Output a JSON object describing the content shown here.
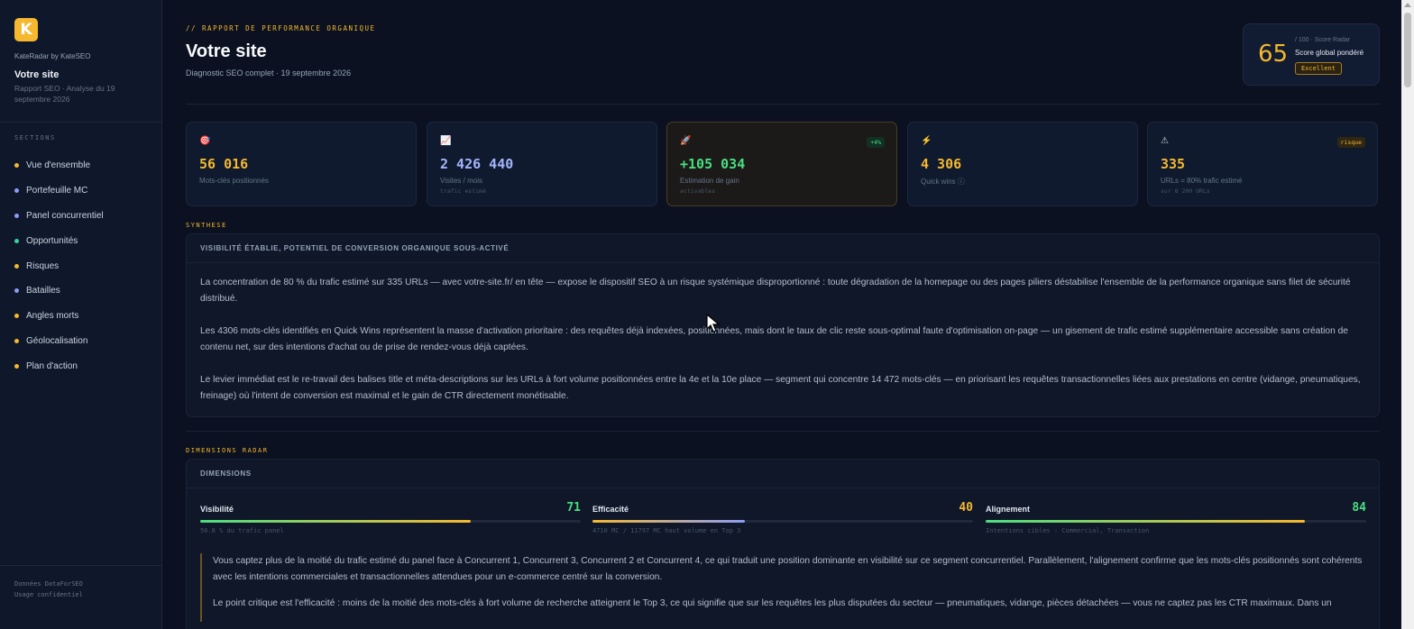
{
  "sidebar": {
    "logo_letter": "K",
    "brand": "KateRadar by KateSEO",
    "site_name": "Votre site",
    "site_sub": "Rapport SEO · Analyse du 19 septembre 2026",
    "sections_label": "SECTIONS",
    "items": [
      {
        "label": "Vue d'ensemble",
        "color": "#f5b82e"
      },
      {
        "label": "Portefeuille MC",
        "color": "#8b9cf4"
      },
      {
        "label": "Panel concurrentiel",
        "color": "#8b9cf4"
      },
      {
        "label": "Opportunités",
        "color": "#34d399"
      },
      {
        "label": "Risques",
        "color": "#f5b82e"
      },
      {
        "label": "Batailles",
        "color": "#8b9cf4"
      },
      {
        "label": "Angles morts",
        "color": "#f5b82e"
      },
      {
        "label": "Géolocalisation",
        "color": "#f5b82e"
      },
      {
        "label": "Plan d'action",
        "color": "#f5b82e"
      }
    ],
    "footer_line1": "Données DataForSEO",
    "footer_line2": "Usage confidentiel"
  },
  "header": {
    "kicker": "// RAPPORT DE PERFORMANCE ORGANIQUE",
    "title": "Votre site",
    "subtitle": "Diagnostic SEO complet · 19 septembre 2026"
  },
  "score": {
    "value": "65",
    "caption": "/ 100 · Score Radar",
    "label": "Score global pondéré",
    "badge": "Excellent"
  },
  "kpis": [
    {
      "icon": "🎯",
      "icon_name": "target-icon",
      "value": "56 016",
      "label": "Mots-clés positionnés",
      "sub": "",
      "tag": "",
      "color": "#f5b82e"
    },
    {
      "icon": "📈",
      "icon_name": "chart-icon",
      "value": "2 426 440",
      "label": "Visites / mois",
      "sub": "trafic estimé",
      "tag": "",
      "color": "#a5b4fc"
    },
    {
      "icon": "🚀",
      "icon_name": "rocket-icon",
      "value": "+105 034",
      "label": "Estimation de gain",
      "sub": "activables",
      "tag": "+4%",
      "color": "#4ade80"
    },
    {
      "icon": "⚡",
      "icon_name": "lightning-icon",
      "value": "4 306",
      "label": "Quick wins ⓘ",
      "sub": "",
      "tag": "",
      "color": "#f5b82e"
    },
    {
      "icon": "⚠",
      "icon_name": "warning-icon",
      "value": "335",
      "label": "URLs = 80% trafic estimé",
      "sub": "sur 8 200 URLs",
      "tag": "risque",
      "color": "#f5b82e"
    }
  ],
  "synthese": {
    "section_label": "SYNTHESE",
    "heading": "VISIBILITÉ ÉTABLIE, POTENTIEL DE CONVERSION ORGANIQUE SOUS-ACTIVÉ",
    "paragraphs": [
      "La concentration de 80 % du trafic estimé sur 335 URLs — avec votre-site.fr/ en tête — expose le dispositif SEO à un risque systémique disproportionné : toute dégradation de la homepage ou des pages piliers déstabilise l'ensemble de la performance organique sans filet de sécurité distribué.",
      "Les 4306 mots-clés identifiés en Quick Wins représentent la masse d'activation prioritaire : des requêtes déjà indexées, positionnées, mais dont le taux de clic reste sous-optimal faute d'optimisation on-page — un gisement de trafic estimé supplémentaire accessible sans création de contenu net, sur des intentions d'achat ou de prise de rendez-vous déjà captées.",
      "Le levier immédiat est le re-travail des balises title et méta-descriptions sur les URLs à fort volume positionnées entre la 4e et la 10e place — segment qui concentre 14 472 mots-clés — en priorisant les requêtes transactionnelles liées aux prestations en centre (vidange, pneumatiques, freinage) où l'intent de conversion est maximal et le gain de CTR directement monétisable."
    ]
  },
  "dimensions": {
    "section_label": "DIMENSIONS RADAR",
    "heading": "DIMENSIONS",
    "items": [
      {
        "name": "Visibilité",
        "score": "71",
        "percent": 71,
        "color": "#4ade80",
        "gradient": "linear-gradient(90deg,#4ade80,#f5b82e)",
        "note": "56.8 % du trafic panel"
      },
      {
        "name": "Efficacité",
        "score": "40",
        "percent": 40,
        "color": "#f5b82e",
        "gradient": "linear-gradient(90deg,#f5b82e,#8b9cf4)",
        "note": "4710 MC / 11797 MC haut volume en Top 3"
      },
      {
        "name": "Alignement",
        "score": "84",
        "percent": 84,
        "color": "#4ade80",
        "gradient": "linear-gradient(90deg,#4ade80,#f5b82e)",
        "note": "Intentions cibles : Commercial, Transaction"
      }
    ],
    "paragraphs": [
      "Vous captez plus de la moitié du trafic estimé du panel face à Concurrent 1, Concurrent 3, Concurrent 2 et Concurrent 4, ce qui traduit une position dominante en visibilité sur ce segment concurrentiel. Parallèlement, l'alignement confirme que les mots-clés positionnés sont cohérents avec les intentions commerciales et transactionnelles attendues pour un e-commerce centré sur la conversion.",
      "Le point critique est l'efficacité : moins de la moitié des mots-clés à fort volume de recherche atteignent le Top 3, ce qui signifie que sur les requêtes les plus disputées du secteur — pneumatiques, vidange, pièces détachées — vous ne captez pas les CTR maximaux. Dans un"
    ]
  }
}
